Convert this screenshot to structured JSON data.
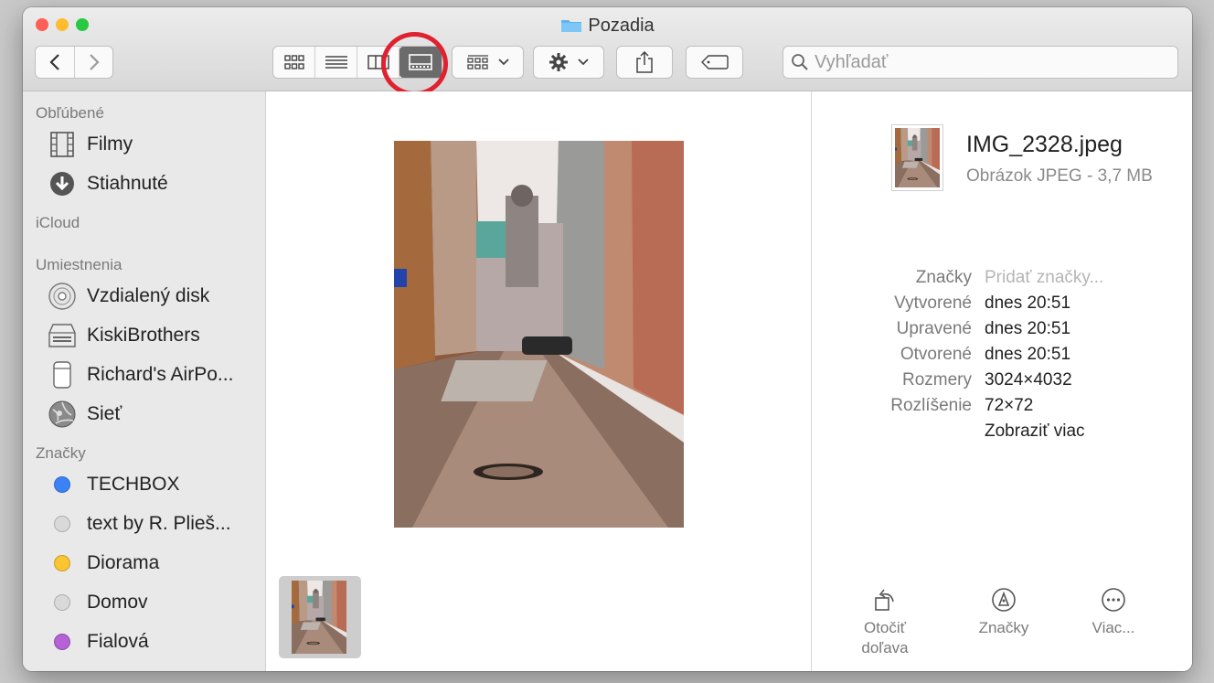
{
  "window": {
    "title": "Pozadia",
    "traffic_colors": [
      "#fe5f57",
      "#febc2e",
      "#28c840"
    ]
  },
  "toolbar": {
    "back_icon": "chevron-left-icon",
    "forward_icon": "chevron-right-icon",
    "view_modes": [
      "icon-view",
      "list-view",
      "column-view",
      "gallery-view"
    ],
    "active_view": "gallery-view",
    "group_icon": "group-by-icon",
    "action_icon": "gear-icon",
    "share_icon": "share-icon",
    "tag_icon": "tag-icon",
    "search_placeholder": "Vyhľadať",
    "highlight_color": "#e0212f"
  },
  "sidebar": {
    "favorites_header": "Obľúbené",
    "favorites": [
      {
        "label": "Filmy",
        "icon": "film-icon"
      },
      {
        "label": "Stiahnuté",
        "icon": "download-icon"
      }
    ],
    "icloud_header": "iCloud",
    "locations_header": "Umiestnenia",
    "locations": [
      {
        "label": "Vzdialený disk",
        "icon": "disc-icon"
      },
      {
        "label": "KiskiBrothers",
        "icon": "server-icon"
      },
      {
        "label": "Richard's AirPo...",
        "icon": "airpods-case-icon"
      },
      {
        "label": "Sieť",
        "icon": "network-icon"
      }
    ],
    "tags_header": "Značky",
    "tags": [
      {
        "label": "TECHBOX",
        "color": "#3b82f6"
      },
      {
        "label": "text by R. Plieš...",
        "color": "#d9d9d9"
      },
      {
        "label": "Diorama",
        "color": "#fbc531"
      },
      {
        "label": "Domov",
        "color": "#d9d9d9"
      },
      {
        "label": "Fialová",
        "color": "#b562d6"
      }
    ]
  },
  "info": {
    "file_name": "IMG_2328.jpeg",
    "file_kind": "Obrázok JPEG - 3,7 MB",
    "rows": [
      {
        "key": "Značky",
        "value": "Pridať značky..."
      },
      {
        "key": "Vytvorené",
        "value": "dnes 20:51"
      },
      {
        "key": "Upravené",
        "value": "dnes 20:51"
      },
      {
        "key": "Otvorené",
        "value": "dnes 20:51"
      },
      {
        "key": "Rozmery",
        "value": "3024×4032"
      },
      {
        "key": "Rozlíšenie",
        "value": "72×72"
      }
    ],
    "more_link": "Zobraziť viac",
    "actions": [
      {
        "line1": "Otočiť",
        "line2": "doľava",
        "icon": "rotate-left-icon"
      },
      {
        "line1": "Značky",
        "line2": "",
        "icon": "markup-icon"
      },
      {
        "line1": "Viac...",
        "line2": "",
        "icon": "more-icon"
      }
    ]
  }
}
